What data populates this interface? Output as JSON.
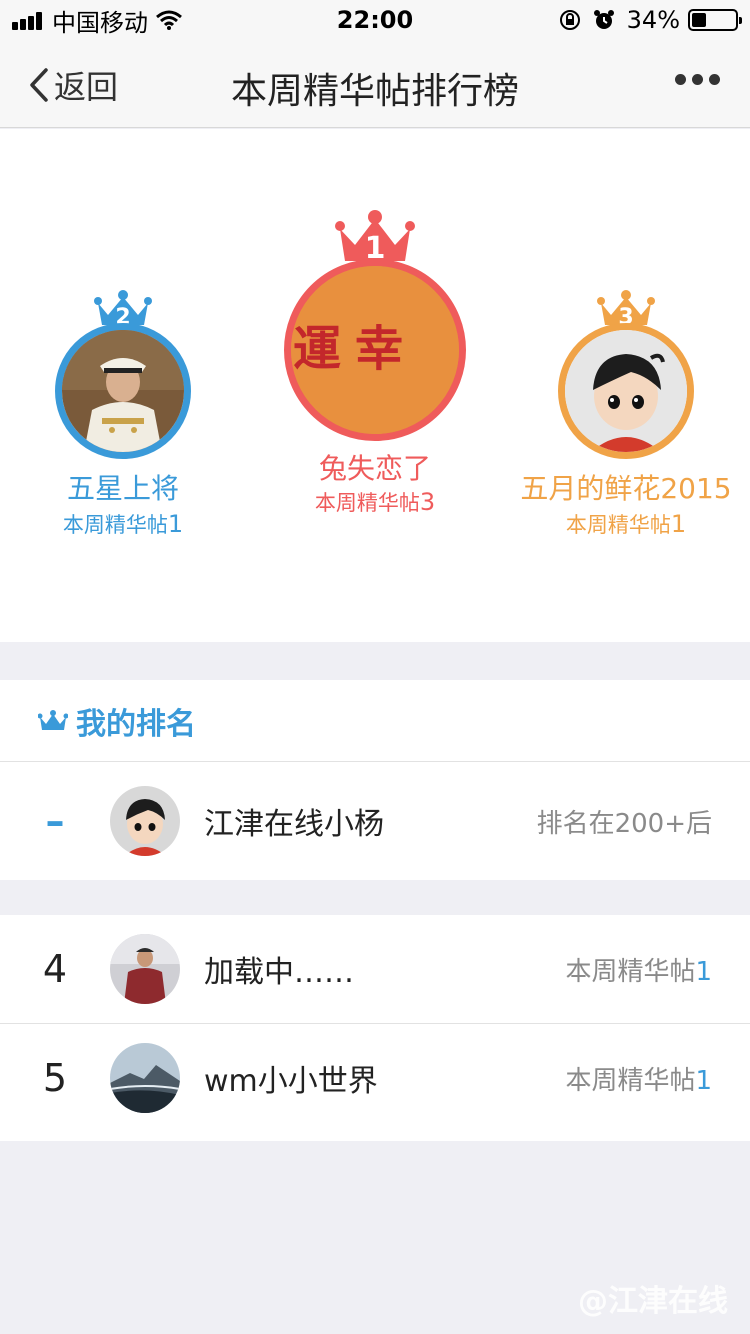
{
  "status_bar": {
    "carrier": "中国移动",
    "time": "22:00",
    "battery_percent": "34%",
    "battery_level": 0.34
  },
  "nav": {
    "back_label": "返回",
    "title": "本周精华帖排行榜"
  },
  "podium": [
    {
      "rank": "1",
      "name": "兔失恋了",
      "count_label": "本周精华帖",
      "count": "3",
      "color": "#ef5b5b",
      "avatar_text": "幸運"
    },
    {
      "rank": "2",
      "name": "五星上将",
      "count_label": "本周精华帖",
      "count": "1",
      "color": "#3a9ad9"
    },
    {
      "rank": "3",
      "name": "五月的鲜花2015",
      "count_label": "本周精华帖",
      "count": "1",
      "color": "#f0a347"
    }
  ],
  "my_rank": {
    "header": "我的排名",
    "rank": "–",
    "name": "江津在线小杨",
    "status": "排名在200+后"
  },
  "list": [
    {
      "rank": "4",
      "name": "加载中……",
      "count_label": "本周精华帖",
      "count": "1"
    },
    {
      "rank": "5",
      "name": "wm小小世界",
      "count_label": "本周精华帖",
      "count": "1"
    }
  ],
  "watermark": "@江津在线",
  "colors": {
    "blue": "#3a9ad9",
    "red": "#ef5b5b",
    "orange": "#f0a347"
  }
}
